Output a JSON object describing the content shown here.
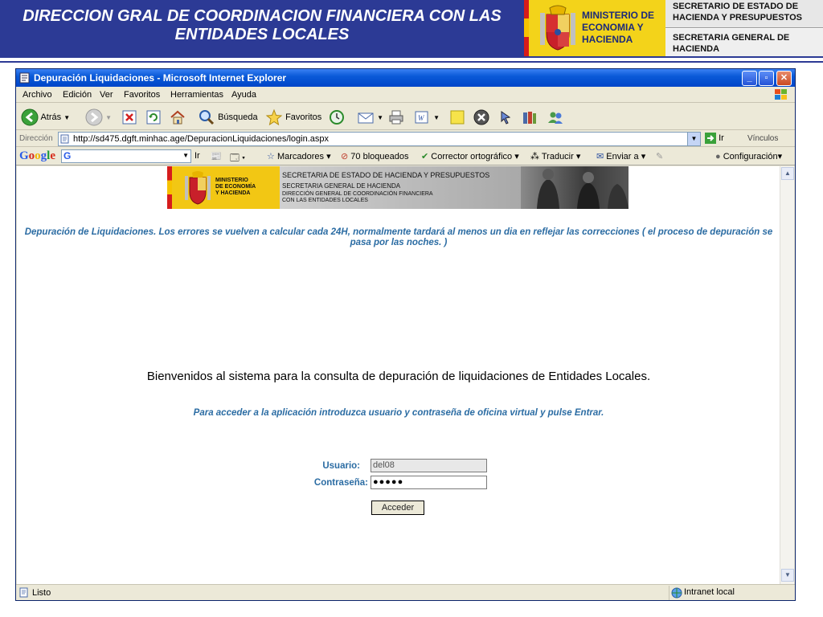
{
  "slide_header": {
    "title": "DIRECCION GRAL DE COORDINACION FINANCIERA CON LAS ENTIDADES LOCALES",
    "ministerio": "MINISTERIO DE ECONOMIA Y HACIENDA",
    "secretario": "SECRETARIO DE ESTADO DE HACIENDA Y PRESUPUESTOS",
    "secretaria": "SECRETARIA GENERAL DE HACIENDA"
  },
  "window": {
    "title": "Depuración Liquidaciones - Microsoft Internet Explorer",
    "minimize": "_",
    "maximize": "▫",
    "close": "✕"
  },
  "menu": [
    "Archivo",
    "Edición",
    "Ver",
    "Favoritos",
    "Herramientas",
    "Ayuda"
  ],
  "toolbar": {
    "back": "Atrás",
    "search": "Búsqueda",
    "favorites": "Favoritos"
  },
  "address": {
    "label": "Dirección",
    "url": "http://sd475.dgft.minhac.age/DepuracionLiquidaciones/login.aspx",
    "go": "Ir",
    "links": "Vínculos"
  },
  "googlebar": {
    "logo": "Google",
    "ir": "Ir",
    "marcadores": "Marcadores",
    "bloqueados": "70 bloqueados",
    "corrector": "Corrector ortográfico",
    "traducir": "Traducir",
    "enviar": "Enviar a",
    "config": "Configuración"
  },
  "banner": {
    "ministerio": "MINISTERIO\nDE ECONOMÍA\nY HACIENDA",
    "line1": "SECRETARIA DE ESTADO DE HACIENDA Y PRESUPUESTOS",
    "line2": "SECRETARIA GENERAL DE HACIENDA",
    "line3": "DIRECCIÓN GENERAL DE COORDINACIÓN FINANCIERA\nCON LAS ENTIDADES LOCALES"
  },
  "page": {
    "info": "Depuración de Liquidaciones. Los errores se vuelven a calcular cada 24H, normalmente tardará al menos un dia en reflejar las correcciones ( el proceso de depuración se pasa por las noches. )",
    "welcome": "Bienvenidos al sistema para la consulta de depuración de liquidaciones de Entidades Locales.",
    "instructions": "Para acceder a la aplicación introduzca usuario y contraseña de oficina virtual y pulse Entrar.",
    "user_label": "Usuario:",
    "user_value": "del08",
    "pass_label": "Contraseña:",
    "pass_value": "●●●●●",
    "submit": "Acceder"
  },
  "status": {
    "text": "Listo",
    "zone": "Intranet local"
  },
  "colors": {
    "header_blue": "#2c3a95",
    "ministerio_yellow": "#f3d31a",
    "link_blue": "#2b6ca3",
    "xp_title": "#0a5ad8"
  }
}
